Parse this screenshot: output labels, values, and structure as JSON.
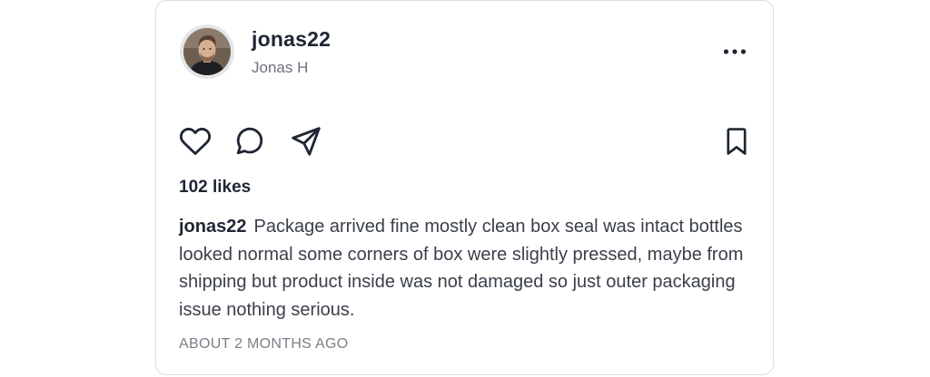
{
  "post": {
    "username": "jonas22",
    "display_name": "Jonas H",
    "likes_text": "102 likes",
    "caption_username": "jonas22",
    "caption_text": "Package arrived fine mostly clean box seal was intact bottles looked normal some corners of box were slightly pressed, maybe from shipping but product inside was not damaged so just outer packaging issue nothing serious.",
    "timestamp": "ABOUT 2 MONTHS AGO"
  },
  "icons": {
    "more": "more-horizontal-icon",
    "like": "heart-icon",
    "comment": "comment-icon",
    "share": "send-icon",
    "save": "bookmark-icon"
  },
  "colors": {
    "text": "#1f2633",
    "muted": "#6b6f78",
    "border": "#dcdde0"
  }
}
